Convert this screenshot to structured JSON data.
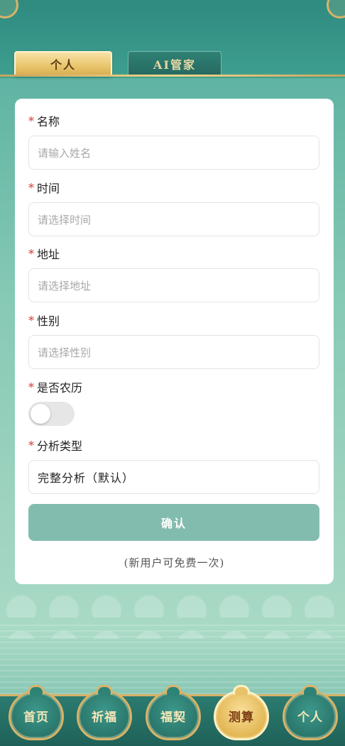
{
  "tabs": [
    {
      "label": "个人",
      "active": true
    },
    {
      "label": "AI管家",
      "active": false
    }
  ],
  "form": {
    "fields": [
      {
        "label": "名称",
        "placeholder": "请输入姓名",
        "required": true
      },
      {
        "label": "时间",
        "placeholder": "请选择时间",
        "required": true
      },
      {
        "label": "地址",
        "placeholder": "请选择地址",
        "required": true
      },
      {
        "label": "性别",
        "placeholder": "请选择性别",
        "required": true
      }
    ],
    "lunar": {
      "label": "是否农历",
      "required": true,
      "value": false
    },
    "analysis": {
      "label": "分析类型",
      "required": true,
      "value": "完整分析（默认）"
    },
    "required_mark": "*",
    "confirm_label": "确认",
    "note": "(新用户可免费一次)"
  },
  "bottom_nav": [
    {
      "label": "首页",
      "active": false
    },
    {
      "label": "祈福",
      "active": false
    },
    {
      "label": "福契",
      "active": false
    },
    {
      "label": "测算",
      "active": true
    },
    {
      "label": "个人",
      "active": false
    }
  ],
  "colors": {
    "accent": "#82bcae",
    "gold": "#d9b469",
    "required": "#d83a2c"
  }
}
